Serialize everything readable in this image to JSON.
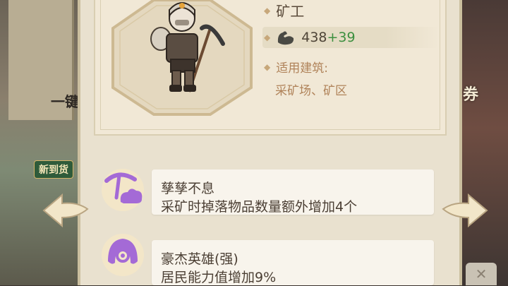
{
  "background": {
    "left_label": "一键",
    "right_label": "券",
    "new_tag": "新到货"
  },
  "character": {
    "job": "矿工",
    "power": "438",
    "power_bonus": "+39",
    "building_label": "适用建筑:",
    "buildings": "采矿场、矿区"
  },
  "skills": [
    {
      "title": "孳孳不息",
      "desc": "采矿时掉落物品数量额外增加4个",
      "icon": "pickaxe-skill-icon"
    },
    {
      "title": "豪杰英雄(强)",
      "desc": "居民能力值增加9%",
      "icon": "hero-helmet-skill-icon"
    }
  ],
  "colors": {
    "accent": "#3c8f3f",
    "skill_icon": "#a46ad6",
    "label": "#b0835a"
  }
}
